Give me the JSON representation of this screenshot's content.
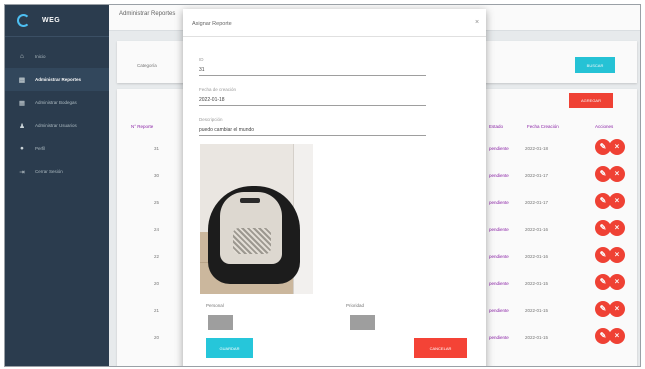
{
  "app": {
    "name": "WEG"
  },
  "sidebar": {
    "items": [
      {
        "label": "Inicio",
        "icon": "home-icon",
        "active": false
      },
      {
        "label": "Administrar Reportes",
        "icon": "reports-icon",
        "active": true
      },
      {
        "label": "Administrar Bodegas",
        "icon": "storage-icon",
        "active": false
      },
      {
        "label": "Administrar Usuarios",
        "icon": "users-icon",
        "active": false
      },
      {
        "label": "Perfil",
        "icon": "profile-icon",
        "active": false
      },
      {
        "label": "Cerrar Sesión",
        "icon": "logout-icon",
        "active": false
      }
    ]
  },
  "topbar": {
    "title": "Administrar Reportes"
  },
  "filters": {
    "category_label": "Categoría",
    "search_button": "BUSCAR"
  },
  "table": {
    "add_button": "AGREGAR",
    "headers": {
      "id": "N° Reporte",
      "estado": "Estado",
      "fecha": "Fecha Creación",
      "acciones": "Acciones"
    },
    "rows": [
      {
        "id": "31",
        "estado": "pendiente",
        "fecha": "2022-01-18"
      },
      {
        "id": "30",
        "estado": "pendiente",
        "fecha": "2022-01-17"
      },
      {
        "id": "25",
        "estado": "pendiente",
        "fecha": "2022-01-17"
      },
      {
        "id": "24",
        "estado": "pendiente",
        "fecha": "2022-01-16"
      },
      {
        "id": "22",
        "estado": "pendiente",
        "fecha": "2022-01-16"
      },
      {
        "id": "20",
        "estado": "pendiente",
        "fecha": "2022-01-15"
      },
      {
        "id": "21",
        "estado": "pendiente",
        "fecha": "2022-01-15"
      },
      {
        "id": "20",
        "estado": "pendiente",
        "fecha": "2022-01-15"
      }
    ]
  },
  "modal": {
    "title": "Asignar Reporte",
    "close_glyph": "×",
    "fields": {
      "id": {
        "label": "ID",
        "value": "31"
      },
      "fecha": {
        "label": "Fecha de creación",
        "value": "2022-01-18"
      },
      "descripcion": {
        "label": "Descripción",
        "value": "puedo cambiar el mundo"
      }
    },
    "selects": {
      "left_label": "Personal",
      "right_label": "Prioridad"
    },
    "buttons": {
      "save": "GUARDAR",
      "cancel": "CANCELAR"
    }
  },
  "colors": {
    "sidebar": "#2c3e50",
    "primary": "#26c6da",
    "danger": "#f44336",
    "accent": "#8e24aa"
  }
}
